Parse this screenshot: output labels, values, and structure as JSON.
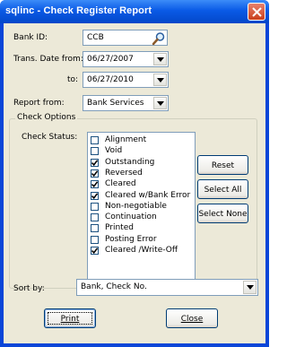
{
  "window": {
    "title": "sqlinc - Check Register Report"
  },
  "bank_id": {
    "label": "Bank ID:",
    "value": "CCB"
  },
  "trans_date_from": {
    "label": "Trans. Date from:",
    "value": "06/27/2007"
  },
  "trans_date_to": {
    "label": "to:",
    "value": "06/27/2010"
  },
  "report_from": {
    "label": "Report from:",
    "value": "Bank Services"
  },
  "check_options": {
    "legend": "Check Options",
    "status_label": "Check Status:",
    "items": [
      {
        "label": "Alignment",
        "checked": false
      },
      {
        "label": "Void",
        "checked": false
      },
      {
        "label": "Outstanding",
        "checked": true
      },
      {
        "label": "Reversed",
        "checked": true
      },
      {
        "label": "Cleared",
        "checked": true
      },
      {
        "label": "Cleared w/Bank Error",
        "checked": true
      },
      {
        "label": "Non-negotiable",
        "checked": false
      },
      {
        "label": "Continuation",
        "checked": false
      },
      {
        "label": "Printed",
        "checked": false
      },
      {
        "label": "Posting Error",
        "checked": false
      },
      {
        "label": "Cleared /Write-Off",
        "checked": true
      }
    ],
    "reset_label": "Reset",
    "select_all_label": "Select All",
    "select_none_label": "Select None"
  },
  "sort_by": {
    "label": "Sort by:",
    "value": "Bank, Check No."
  },
  "buttons": {
    "print": "Print",
    "close": "Close"
  }
}
